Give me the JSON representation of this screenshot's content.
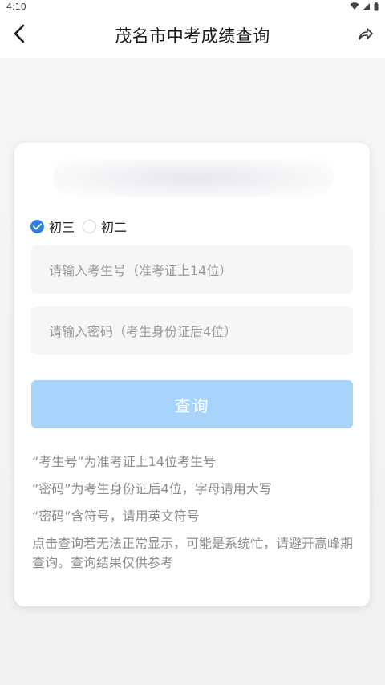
{
  "status_bar": {
    "time": "4:10"
  },
  "header": {
    "title": "茂名市中考成绩查询"
  },
  "icons": {
    "back": "chevron-left-icon",
    "share": "share-arrow-icon"
  },
  "form": {
    "grade_options": [
      {
        "label": "初三",
        "checked": true
      },
      {
        "label": "初二",
        "checked": false
      }
    ],
    "exam_number_placeholder": "请输入考生号（准考证上14位）",
    "password_placeholder": "请输入密码（考生身份证后4位）",
    "submit_label": "查询"
  },
  "notes": [
    "“考生号”为准考证上14位考生号",
    "“密码”为考生身份证后4位，字母请用大写",
    "“密码”含符号，请用英文符号",
    "点击查询若无法正常显示，可能是系统忙，请避开高峰期查询。查询结果仅供参考"
  ],
  "colors": {
    "accent": "#2d7fe0",
    "button_disabled": "#a8d3fb",
    "hint_text": "#8a8a8a"
  }
}
